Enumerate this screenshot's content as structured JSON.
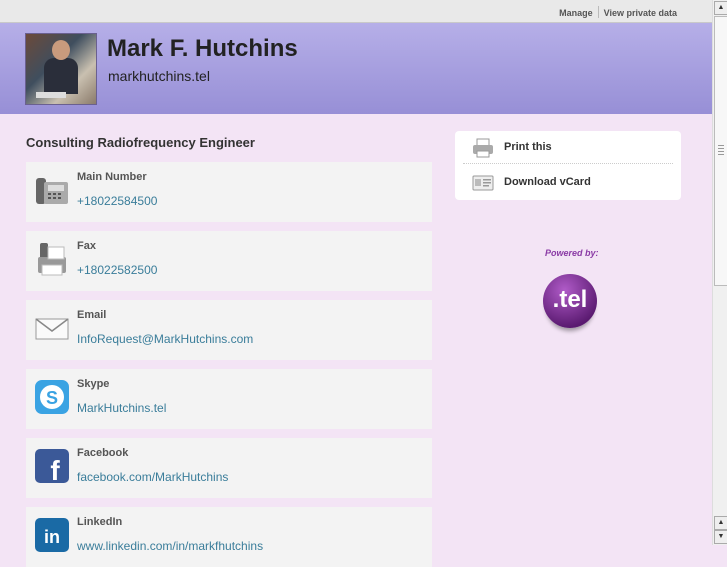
{
  "topbar": {
    "manage": "Manage",
    "view_private": "View private data"
  },
  "header": {
    "name": "Mark F. Hutchins",
    "domain": "markhutchins.tel"
  },
  "job_title": "Consulting Radiofrequency Engineer",
  "contacts": [
    {
      "label": "Main Number",
      "value": "+18022584500",
      "icon": "phone-icon"
    },
    {
      "label": "Fax",
      "value": "+18022582500",
      "icon": "fax-icon"
    },
    {
      "label": "Email",
      "value": "InfoRequest@MarkHutchins.com",
      "icon": "email-icon"
    },
    {
      "label": "Skype",
      "value": "MarkHutchins.tel",
      "icon": "skype-icon"
    },
    {
      "label": "Facebook",
      "value": "facebook.com/MarkHutchins",
      "icon": "facebook-icon"
    },
    {
      "label": "LinkedIn",
      "value": "www.linkedin.com/in/markfhutchins",
      "icon": "linkedin-icon"
    }
  ],
  "side": {
    "print": "Print this",
    "vcard": "Download vCard"
  },
  "powered": {
    "label": "Powered by:",
    "logo_text": ".tel"
  },
  "colors": {
    "header": "#a69fe0",
    "background": "#f3e4f5",
    "link": "#3a7d9a",
    "accent": "#8a3aa5"
  }
}
